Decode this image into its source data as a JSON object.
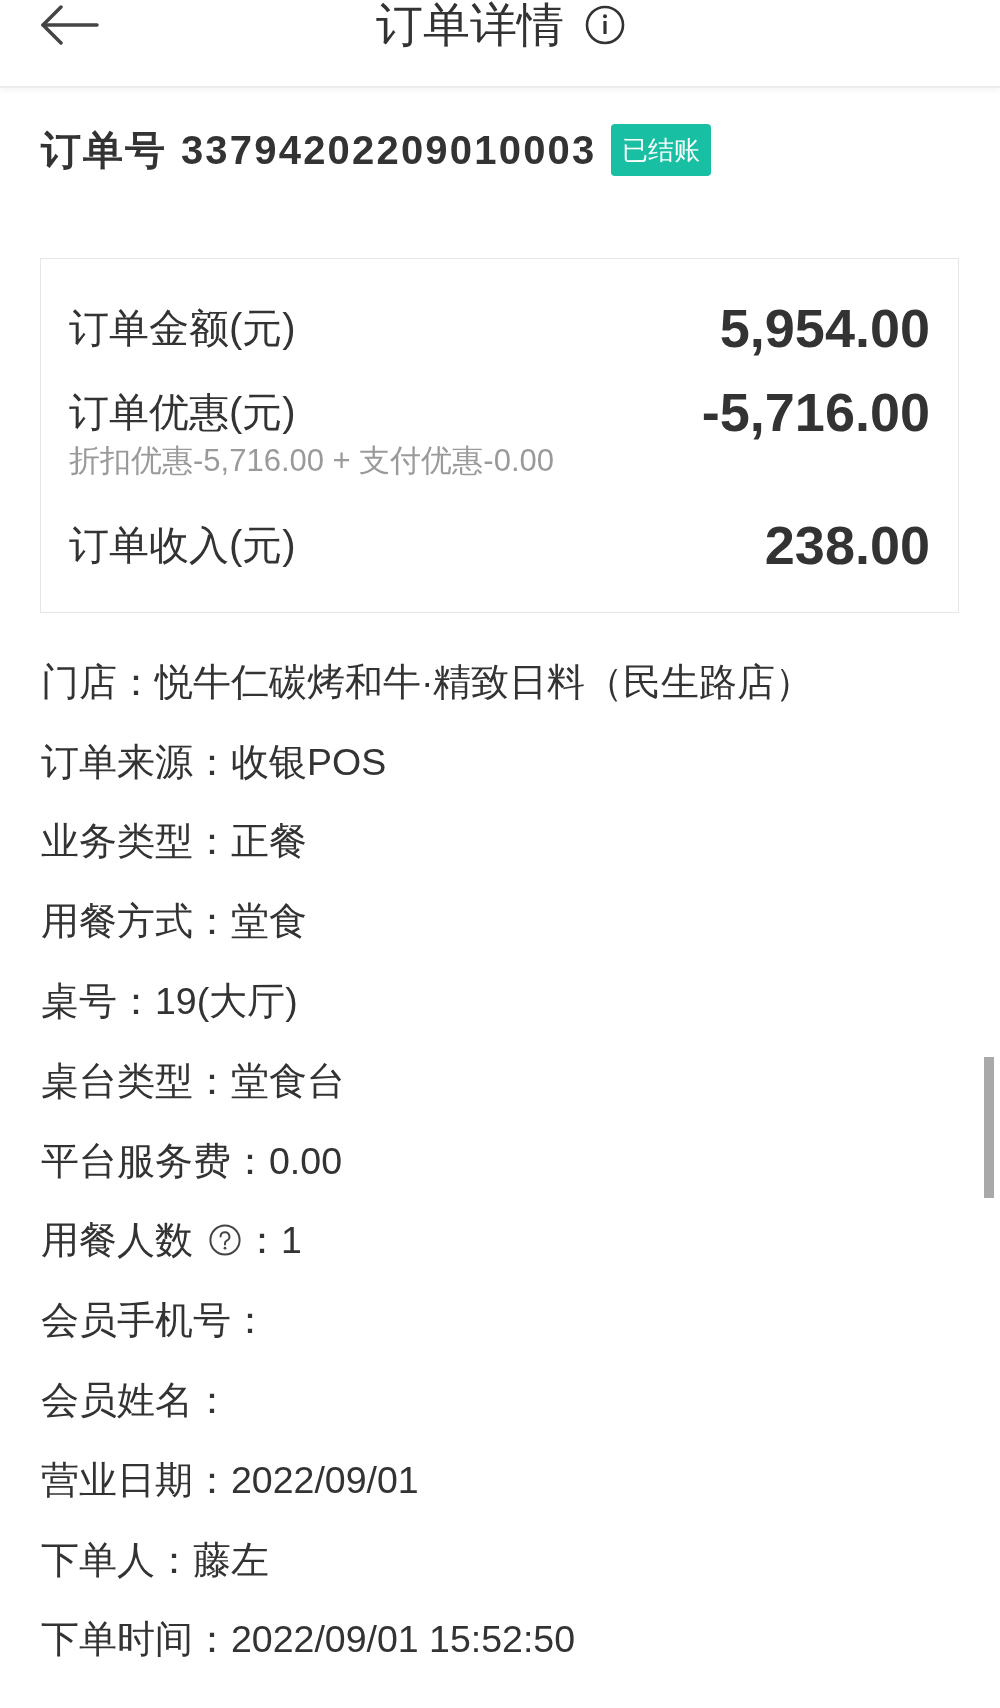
{
  "header": {
    "title": "订单详情"
  },
  "order": {
    "title": "订单号 33794202209010003",
    "status": "已结账"
  },
  "summary": [
    {
      "label": "订单金额(元)",
      "amount": "5,954.00"
    },
    {
      "label": "订单优惠(元)",
      "amount": "-5,716.00",
      "note": "折扣优惠-5,716.00 + 支付优惠-0.00"
    },
    {
      "label": "订单收入(元)",
      "amount": "238.00"
    }
  ],
  "details": [
    {
      "text": "门店：悦牛仁碳烤和牛·精致日料（民生路店）",
      "help": false
    },
    {
      "text": "订单来源：收银POS",
      "help": false
    },
    {
      "text": "业务类型：正餐",
      "help": false
    },
    {
      "text": "用餐方式：堂食",
      "help": false
    },
    {
      "text": "桌号：19(大厅)",
      "help": false
    },
    {
      "text": "桌台类型：堂食台",
      "help": false
    },
    {
      "text": "平台服务费：0.00",
      "help": false
    },
    {
      "text": "用餐人数",
      "help": true,
      "after": "：1"
    },
    {
      "text": "会员手机号：",
      "help": false
    },
    {
      "text": "会员姓名：",
      "help": false
    },
    {
      "text": "营业日期：2022/09/01",
      "help": false
    },
    {
      "text": "下单人：藤左",
      "help": false
    },
    {
      "text": "下单时间：2022/09/01 15:52:50",
      "help": false
    }
  ]
}
